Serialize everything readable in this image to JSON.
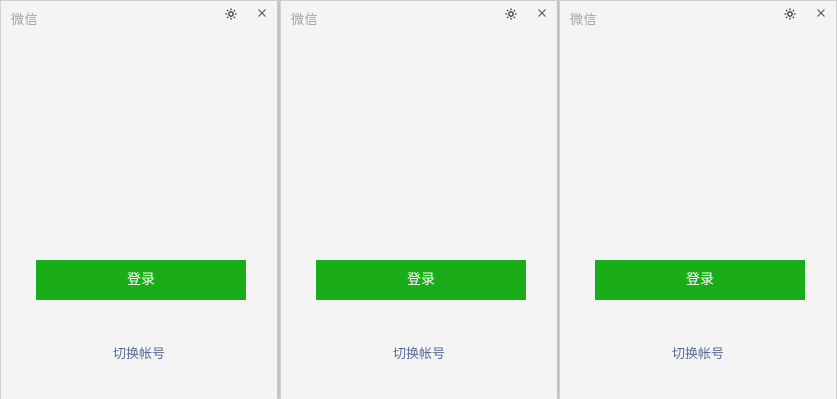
{
  "windows": [
    {
      "title": "微信",
      "login_label": "登录",
      "switch_account_label": "切换帐号"
    },
    {
      "title": "微信",
      "login_label": "登录",
      "switch_account_label": "切换帐号"
    },
    {
      "title": "微信",
      "login_label": "登录",
      "switch_account_label": "切换帐号"
    }
  ],
  "icons": {
    "settings": "gear-icon",
    "close": "close-icon"
  },
  "colors": {
    "window_bg": "#f4f4f4",
    "primary_button": "#1aad19",
    "button_text": "#ffffff",
    "link": "#576b95",
    "title_text": "#a3a3a3"
  }
}
